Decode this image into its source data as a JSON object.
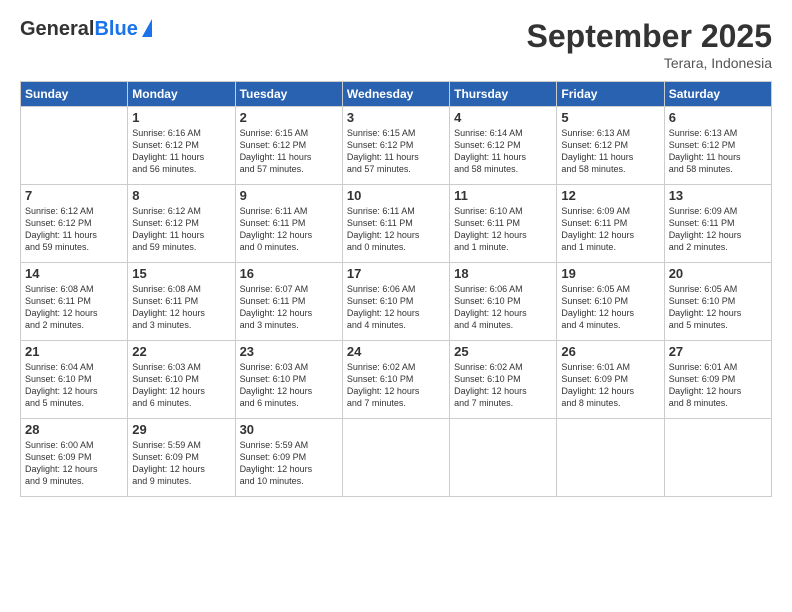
{
  "header": {
    "logo_general": "General",
    "logo_blue": "Blue",
    "month_title": "September 2025",
    "location": "Terara, Indonesia"
  },
  "days_of_week": [
    "Sunday",
    "Monday",
    "Tuesday",
    "Wednesday",
    "Thursday",
    "Friday",
    "Saturday"
  ],
  "weeks": [
    [
      {
        "day": "",
        "info": ""
      },
      {
        "day": "1",
        "info": "Sunrise: 6:16 AM\nSunset: 6:12 PM\nDaylight: 11 hours\nand 56 minutes."
      },
      {
        "day": "2",
        "info": "Sunrise: 6:15 AM\nSunset: 6:12 PM\nDaylight: 11 hours\nand 57 minutes."
      },
      {
        "day": "3",
        "info": "Sunrise: 6:15 AM\nSunset: 6:12 PM\nDaylight: 11 hours\nand 57 minutes."
      },
      {
        "day": "4",
        "info": "Sunrise: 6:14 AM\nSunset: 6:12 PM\nDaylight: 11 hours\nand 58 minutes."
      },
      {
        "day": "5",
        "info": "Sunrise: 6:13 AM\nSunset: 6:12 PM\nDaylight: 11 hours\nand 58 minutes."
      },
      {
        "day": "6",
        "info": "Sunrise: 6:13 AM\nSunset: 6:12 PM\nDaylight: 11 hours\nand 58 minutes."
      }
    ],
    [
      {
        "day": "7",
        "info": "Sunrise: 6:12 AM\nSunset: 6:12 PM\nDaylight: 11 hours\nand 59 minutes."
      },
      {
        "day": "8",
        "info": "Sunrise: 6:12 AM\nSunset: 6:12 PM\nDaylight: 11 hours\nand 59 minutes."
      },
      {
        "day": "9",
        "info": "Sunrise: 6:11 AM\nSunset: 6:11 PM\nDaylight: 12 hours\nand 0 minutes."
      },
      {
        "day": "10",
        "info": "Sunrise: 6:11 AM\nSunset: 6:11 PM\nDaylight: 12 hours\nand 0 minutes."
      },
      {
        "day": "11",
        "info": "Sunrise: 6:10 AM\nSunset: 6:11 PM\nDaylight: 12 hours\nand 1 minute."
      },
      {
        "day": "12",
        "info": "Sunrise: 6:09 AM\nSunset: 6:11 PM\nDaylight: 12 hours\nand 1 minute."
      },
      {
        "day": "13",
        "info": "Sunrise: 6:09 AM\nSunset: 6:11 PM\nDaylight: 12 hours\nand 2 minutes."
      }
    ],
    [
      {
        "day": "14",
        "info": "Sunrise: 6:08 AM\nSunset: 6:11 PM\nDaylight: 12 hours\nand 2 minutes."
      },
      {
        "day": "15",
        "info": "Sunrise: 6:08 AM\nSunset: 6:11 PM\nDaylight: 12 hours\nand 3 minutes."
      },
      {
        "day": "16",
        "info": "Sunrise: 6:07 AM\nSunset: 6:11 PM\nDaylight: 12 hours\nand 3 minutes."
      },
      {
        "day": "17",
        "info": "Sunrise: 6:06 AM\nSunset: 6:10 PM\nDaylight: 12 hours\nand 4 minutes."
      },
      {
        "day": "18",
        "info": "Sunrise: 6:06 AM\nSunset: 6:10 PM\nDaylight: 12 hours\nand 4 minutes."
      },
      {
        "day": "19",
        "info": "Sunrise: 6:05 AM\nSunset: 6:10 PM\nDaylight: 12 hours\nand 4 minutes."
      },
      {
        "day": "20",
        "info": "Sunrise: 6:05 AM\nSunset: 6:10 PM\nDaylight: 12 hours\nand 5 minutes."
      }
    ],
    [
      {
        "day": "21",
        "info": "Sunrise: 6:04 AM\nSunset: 6:10 PM\nDaylight: 12 hours\nand 5 minutes."
      },
      {
        "day": "22",
        "info": "Sunrise: 6:03 AM\nSunset: 6:10 PM\nDaylight: 12 hours\nand 6 minutes."
      },
      {
        "day": "23",
        "info": "Sunrise: 6:03 AM\nSunset: 6:10 PM\nDaylight: 12 hours\nand 6 minutes."
      },
      {
        "day": "24",
        "info": "Sunrise: 6:02 AM\nSunset: 6:10 PM\nDaylight: 12 hours\nand 7 minutes."
      },
      {
        "day": "25",
        "info": "Sunrise: 6:02 AM\nSunset: 6:10 PM\nDaylight: 12 hours\nand 7 minutes."
      },
      {
        "day": "26",
        "info": "Sunrise: 6:01 AM\nSunset: 6:09 PM\nDaylight: 12 hours\nand 8 minutes."
      },
      {
        "day": "27",
        "info": "Sunrise: 6:01 AM\nSunset: 6:09 PM\nDaylight: 12 hours\nand 8 minutes."
      }
    ],
    [
      {
        "day": "28",
        "info": "Sunrise: 6:00 AM\nSunset: 6:09 PM\nDaylight: 12 hours\nand 9 minutes."
      },
      {
        "day": "29",
        "info": "Sunrise: 5:59 AM\nSunset: 6:09 PM\nDaylight: 12 hours\nand 9 minutes."
      },
      {
        "day": "30",
        "info": "Sunrise: 5:59 AM\nSunset: 6:09 PM\nDaylight: 12 hours\nand 10 minutes."
      },
      {
        "day": "",
        "info": ""
      },
      {
        "day": "",
        "info": ""
      },
      {
        "day": "",
        "info": ""
      },
      {
        "day": "",
        "info": ""
      }
    ]
  ]
}
